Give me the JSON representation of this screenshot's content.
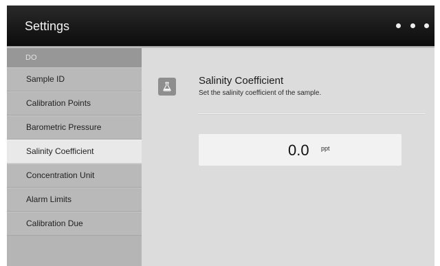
{
  "header": {
    "title": "Settings",
    "more_icon": "more-dots-icon"
  },
  "sidebar": {
    "group_label": "DO",
    "items": [
      {
        "label": "Sample ID"
      },
      {
        "label": "Calibration Points"
      },
      {
        "label": "Barometric Pressure"
      },
      {
        "label": "Salinity Coefficient",
        "active": true
      },
      {
        "label": "Concentration Unit"
      },
      {
        "label": "Alarm Limits"
      },
      {
        "label": "Calibration Due"
      }
    ]
  },
  "main": {
    "icon": "flask-icon",
    "title": "Salinity Coefficient",
    "description": "Set the salinity coefficient of the sample.",
    "value": "0.0",
    "unit": "ppt"
  },
  "colors": {
    "header_bg": "#111111",
    "sidebar_bg": "#b5b5b5",
    "sidebar_group_bg": "#979797",
    "active_item_bg": "#e9e9e9",
    "content_bg": "#dcdcdc",
    "field_bg": "#f2f2f2"
  }
}
